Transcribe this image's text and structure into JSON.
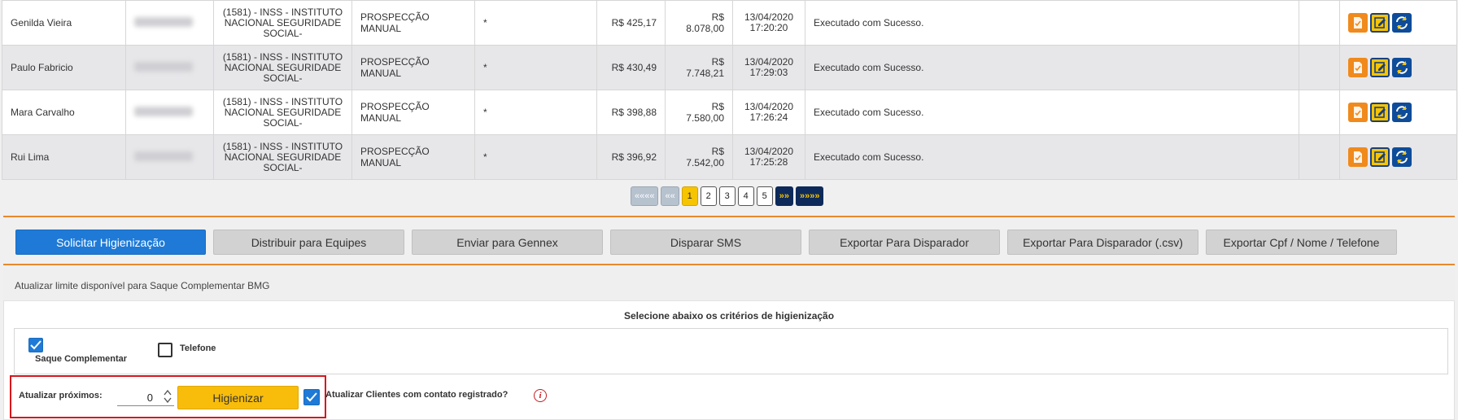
{
  "rows": [
    {
      "name": "Genilda Vieira",
      "agency": "(1581) - INSS - INSTITUTO NACIONAL SEGURIDADE SOCIAL-",
      "origin": "PROSPECÇÃO MANUAL",
      "mark": "*",
      "val1": "R$ 425,17",
      "val2": "R$ 8.078,00",
      "date": "13/04/2020",
      "time": "17:20:20",
      "status": "Executado com Sucesso."
    },
    {
      "name": "Paulo Fabricio",
      "agency": "(1581) - INSS - INSTITUTO NACIONAL SEGURIDADE SOCIAL-",
      "origin": "PROSPECÇÃO MANUAL",
      "mark": "*",
      "val1": "R$ 430,49",
      "val2": "R$ 7.748,21",
      "date": "13/04/2020",
      "time": "17:29:03",
      "status": "Executado com Sucesso."
    },
    {
      "name": "Mara Carvalho",
      "agency": "(1581) - INSS - INSTITUTO NACIONAL SEGURIDADE SOCIAL-",
      "origin": "PROSPECÇÃO MANUAL",
      "mark": "*",
      "val1": "R$ 398,88",
      "val2": "R$ 7.580,00",
      "date": "13/04/2020",
      "time": "17:26:24",
      "status": "Executado com Sucesso."
    },
    {
      "name": "Rui Lima",
      "agency": "(1581) - INSS - INSTITUTO NACIONAL SEGURIDADE SOCIAL-",
      "origin": "PROSPECÇÃO MANUAL",
      "mark": "*",
      "val1": "R$ 396,92",
      "val2": "R$ 7.542,00",
      "date": "13/04/2020",
      "time": "17:25:28",
      "status": "Executado com Sucesso."
    }
  ],
  "pagination": {
    "first": "««««",
    "prev": "««",
    "pages": [
      "1",
      "2",
      "3",
      "4",
      "5"
    ],
    "next": "»»",
    "last": "»»»»",
    "current": "1"
  },
  "toolbar": {
    "solicitar": "Solicitar Higienização",
    "distribuir": "Distribuir para Equipes",
    "gennex": "Enviar para Gennex",
    "sms": "Disparar SMS",
    "exportar": "Exportar Para Disparador",
    "exportar_csv": "Exportar Para Disparador (.csv)",
    "exportar_cpf": "Exportar Cpf / Nome / Telefone"
  },
  "limit_text": "Atualizar limite disponível para Saque Complementar BMG",
  "criteria": {
    "title": "Selecione abaixo os critérios de higienização",
    "saque_label": "Saque Complementar",
    "telefone_label": "Telefone"
  },
  "update": {
    "label": "Atualizar próximos:",
    "value": "0",
    "button": "Higienizar",
    "checkbox_label": "Atualizar Clientes com contato registrado?"
  },
  "colors": {
    "primary": "#1e7ad6",
    "accent": "#f8bd0a",
    "orange": "#e88a2d",
    "highlight": "#d6151b"
  }
}
